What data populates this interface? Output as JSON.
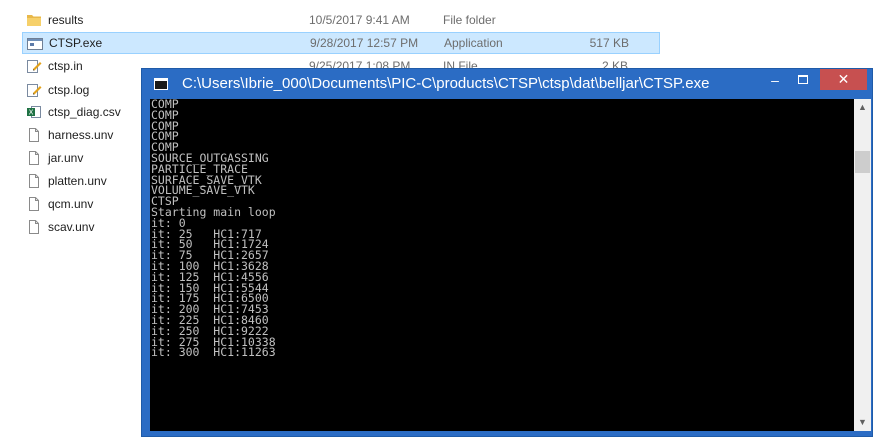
{
  "explorer": {
    "files": [
      {
        "name": "results",
        "date": "10/5/2017 9:41 AM",
        "type": "File folder",
        "size": "",
        "icon": "folder-icon",
        "selected": false
      },
      {
        "name": "CTSP.exe",
        "date": "9/28/2017 12:57 PM",
        "type": "Application",
        "size": "517 KB",
        "icon": "application-icon",
        "selected": true
      },
      {
        "name": "ctsp.in",
        "date": "9/25/2017 1:08 PM",
        "type": "IN File",
        "size": "2 KB",
        "icon": "edit-file-icon",
        "selected": false
      },
      {
        "name": "ctsp.log",
        "date": "",
        "type": "",
        "size": "",
        "icon": "edit-file-icon",
        "selected": false
      },
      {
        "name": "ctsp_diag.csv",
        "date": "",
        "type": "",
        "size": "",
        "icon": "excel-file-icon",
        "selected": false
      },
      {
        "name": "harness.unv",
        "date": "",
        "type": "",
        "size": "",
        "icon": "file-icon",
        "selected": false
      },
      {
        "name": "jar.unv",
        "date": "",
        "type": "",
        "size": "",
        "icon": "file-icon",
        "selected": false
      },
      {
        "name": "platten.unv",
        "date": "",
        "type": "",
        "size": "",
        "icon": "file-icon",
        "selected": false
      },
      {
        "name": "qcm.unv",
        "date": "",
        "type": "",
        "size": "",
        "icon": "file-icon",
        "selected": false
      },
      {
        "name": "scav.unv",
        "date": "",
        "type": "",
        "size": "",
        "icon": "file-icon",
        "selected": false
      }
    ]
  },
  "console": {
    "title": "C:\\Users\\Ibrie_000\\Documents\\PIC-C\\products\\CTSP\\ctsp\\dat\\belljar\\CTSP.exe",
    "minimize_glyph": "–",
    "close_glyph": "✕",
    "scroll_up_glyph": "▲",
    "scroll_down_glyph": "▼",
    "lines": [
      "COMP",
      "COMP",
      "COMP",
      "COMP",
      "COMP",
      "SOURCE_OUTGASSING",
      "PARTICLE_TRACE",
      "SURFACE_SAVE_VTK",
      "VOLUME_SAVE_VTK",
      "CTSP",
      "Starting main loop",
      "it: 0",
      "it: 25   HC1:717",
      "it: 50   HC1:1724",
      "it: 75   HC1:2657",
      "it: 100  HC1:3628",
      "it: 125  HC1:4556",
      "it: 150  HC1:5544",
      "it: 175  HC1:6500",
      "it: 200  HC1:7453",
      "it: 225  HC1:8460",
      "it: 250  HC1:9222",
      "it: 275  HC1:10338",
      "it: 300  HC1:11263"
    ]
  },
  "colors": {
    "title_bar": "#2b6cc4",
    "close_button": "#c75050",
    "selection": "#cce8ff",
    "terminal_bg": "#000000",
    "terminal_text": "#c0c0c0"
  }
}
